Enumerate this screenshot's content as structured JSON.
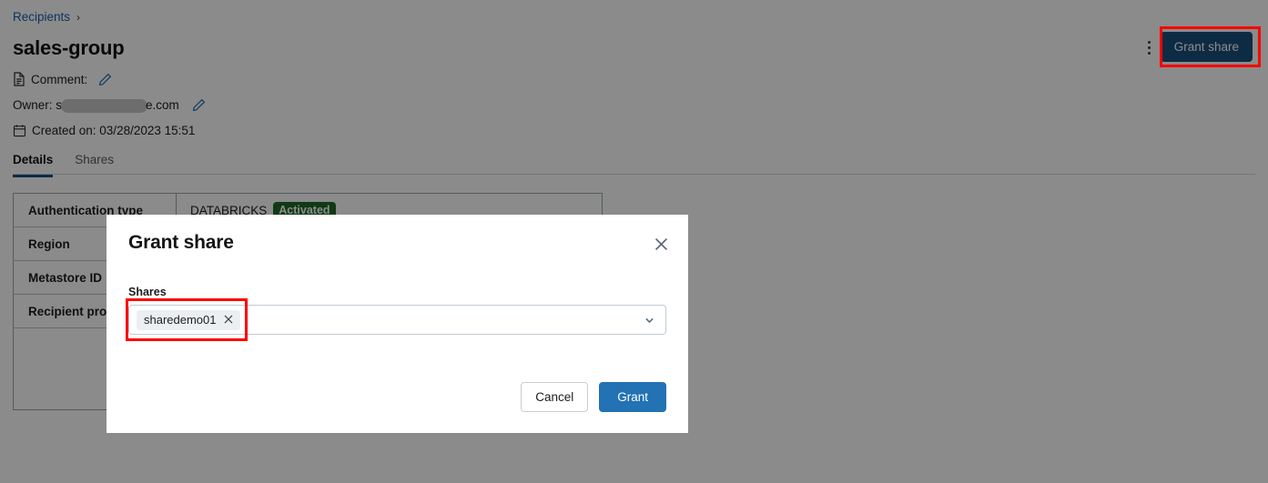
{
  "breadcrumb": {
    "link": "Recipients",
    "separator": "›"
  },
  "page_title": "sales-group",
  "meta": {
    "comment_label": "Comment:",
    "comment_icon": "document-icon",
    "comment_edit_icon": "pencil-icon",
    "owner_prefix": "Owner: s",
    "owner_suffix": "e.com",
    "owner_edit_icon": "pencil-icon",
    "created_label": "Created on: 03/28/2023 15:51",
    "created_icon": "calendar-icon"
  },
  "header_actions": {
    "kebab_icon": "more-vertical-icon",
    "grant_share_label": "Grant share"
  },
  "tabs": [
    {
      "label": "Details",
      "active": true
    },
    {
      "label": "Shares",
      "active": false
    }
  ],
  "details_table": {
    "rows": [
      {
        "key": "Authentication type",
        "value": "DATABRICKS",
        "badge": "Activated"
      },
      {
        "key": "Region",
        "value": ""
      },
      {
        "key": "Metastore ID",
        "value": ""
      },
      {
        "key": "Recipient prop",
        "value": ""
      }
    ]
  },
  "dialog": {
    "title": "Grant share",
    "close_icon": "close-icon",
    "field_label": "Shares",
    "chip": {
      "label": "sharedemo01",
      "remove_icon": "close-icon"
    },
    "chevron_icon": "chevron-down-icon",
    "cancel_label": "Cancel",
    "grant_label": "Grant"
  },
  "colors": {
    "accent_blue": "#2272b4",
    "dark_blue": "#1b4f7e",
    "link_blue": "#1b5faa",
    "badge_green": "#1e6b27",
    "highlight_red": "#ff0000"
  }
}
